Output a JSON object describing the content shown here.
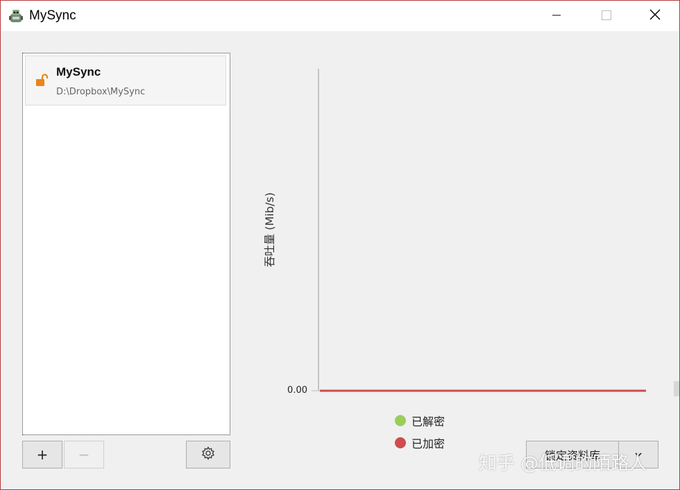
{
  "window": {
    "title": "MySync",
    "buttons": [
      "minimize",
      "maximize",
      "close"
    ]
  },
  "vaults": {
    "items": [
      {
        "name": "MySync",
        "path": "D:\\Dropbox\\MySync",
        "icon": "unlocked-padlock-icon"
      }
    ]
  },
  "toolbar": {
    "add_label": "+",
    "remove_label": "−",
    "settings_icon": "gear-icon"
  },
  "chart_data": {
    "type": "line",
    "ylabel": "吞吐量 (Mib/s)",
    "y_ticks": [
      "0.00"
    ],
    "ylim": [
      0,
      null
    ],
    "series": [
      {
        "name": "已解密",
        "color": "#9acd5a",
        "values": [
          0
        ]
      },
      {
        "name": "已加密",
        "color": "#cd4d4d",
        "values": [
          0
        ]
      }
    ],
    "legend_position": "bottom"
  },
  "actions": {
    "lock_label": "锁定资料库",
    "dropdown_icon": "chevron-down-icon"
  },
  "watermark": "知乎 @低调的陌路人",
  "colors": {
    "accent_lock": "#e8861a",
    "window_border": "#b33a3a"
  }
}
